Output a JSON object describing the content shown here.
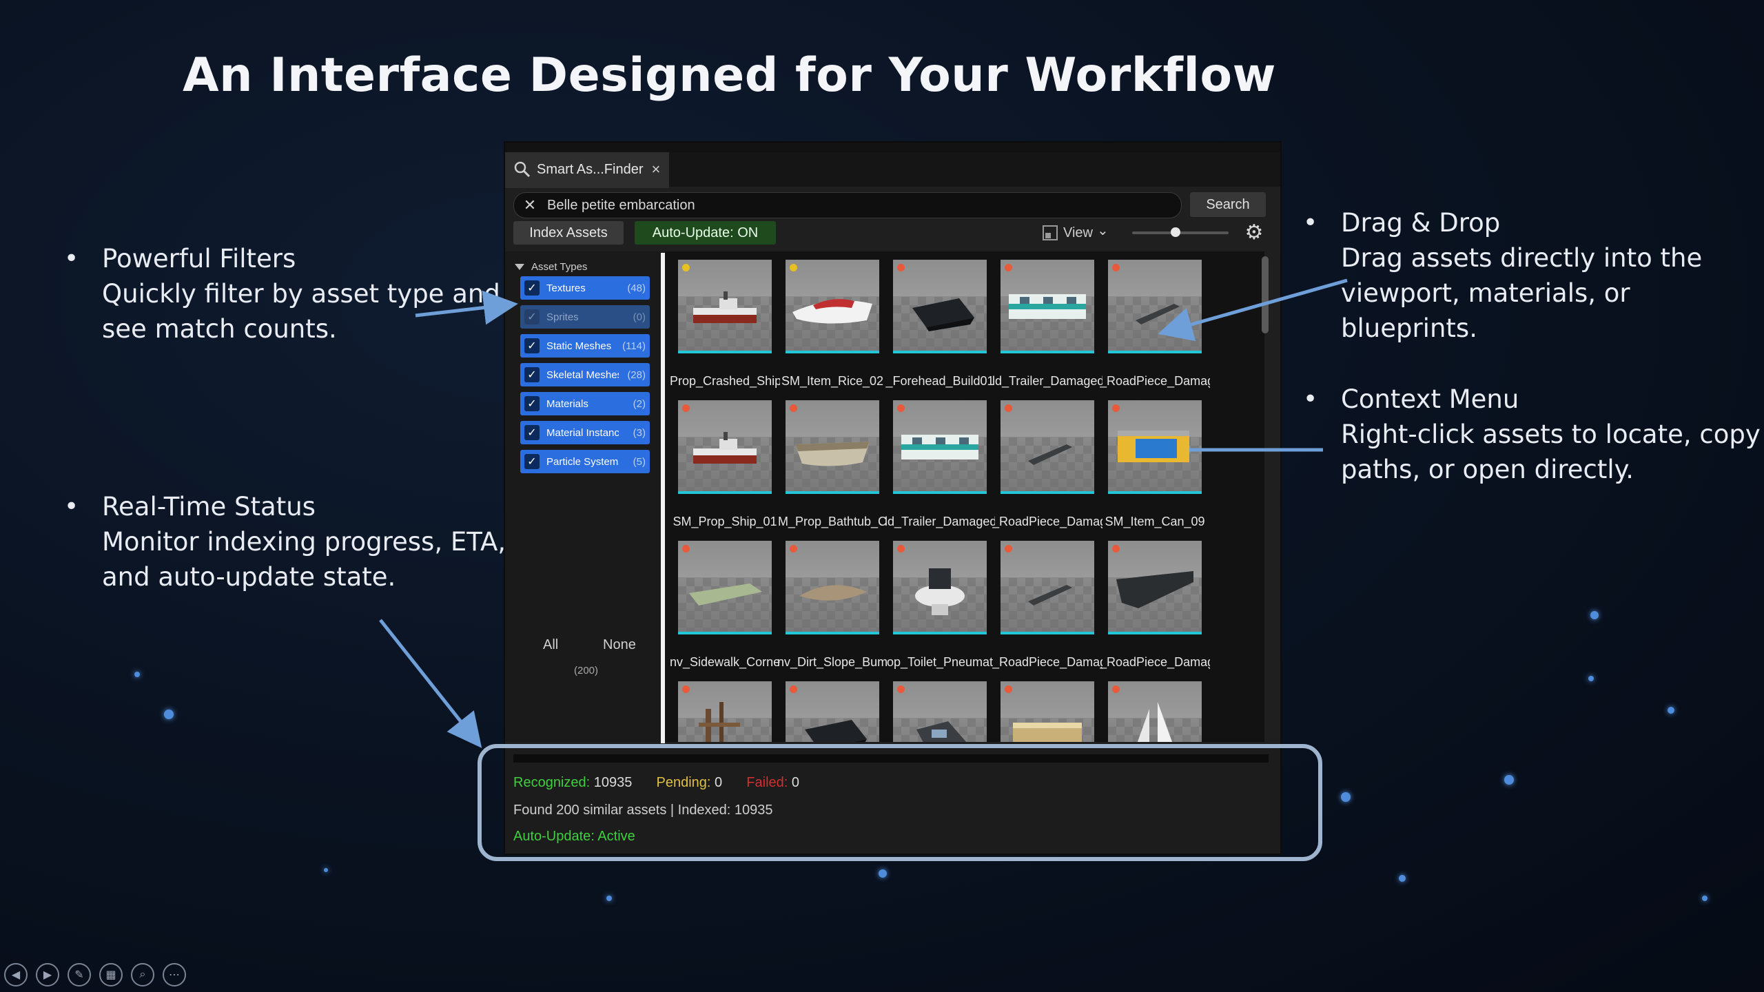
{
  "slide": {
    "title": "An Interface Designed for Your Workflow",
    "bullets_left": [
      {
        "title": "Powerful Filters",
        "lines": [
          "Quickly filter by asset type and",
          "see match counts."
        ]
      },
      {
        "title": "Real-Time Status",
        "lines": [
          "Monitor indexing progress, ETA,",
          "and auto-update state."
        ]
      }
    ],
    "bullets_right": [
      {
        "title": "Drag & Drop",
        "lines": [
          "Drag assets directly into the",
          "viewport, materials, or blueprints."
        ]
      },
      {
        "title": "Context Menu",
        "lines": [
          "Right-click assets to locate, copy",
          "paths, or open directly."
        ]
      }
    ],
    "bullet_glyph": "•"
  },
  "editor": {
    "tab": {
      "label": "Smart As...Finder",
      "close": "×",
      "icon": "search-icon"
    },
    "search": {
      "value": "Belle petite embarcation",
      "clear": "✕",
      "button": "Search"
    },
    "toolbar": {
      "index_label": "Index Assets",
      "auto_update_label": "Auto-Update: ON",
      "view_label": "View",
      "view_chevron": "⌄",
      "settings_icon": "gear-icon",
      "thumb_size_fraction": 0.45
    },
    "filters": {
      "header": "Asset Types",
      "items": [
        {
          "label": "Textures",
          "count": "(48)",
          "checked": true
        },
        {
          "label": "Sprites",
          "count": "(0)",
          "checked": true
        },
        {
          "label": "Static Meshes",
          "count": "(114)",
          "checked": true
        },
        {
          "label": "Skeletal Meshes",
          "count": "(28)",
          "checked": true
        },
        {
          "label": "Materials",
          "count": "(2)",
          "checked": true
        },
        {
          "label": "Material Instances",
          "count": "(3)",
          "checked": true
        },
        {
          "label": "Particle Systems",
          "count": "(5)",
          "checked": true
        }
      ],
      "all_label": "All",
      "none_label": "None",
      "total": "(200)"
    },
    "assets": [
      {
        "name": "Prop_Crashed_Ship",
        "badge": "#e8c020",
        "shape": "ship"
      },
      {
        "name": "SM_Item_Rice_02",
        "badge": "#e8c020",
        "shape": "hull-white"
      },
      {
        "name": "_Forehead_Build01",
        "badge": "#e85a3a",
        "shape": "hull-dark"
      },
      {
        "name": "ld_Trailer_Damaged",
        "badge": "#e85a3a",
        "shape": "trailer"
      },
      {
        "name": "_RoadPiece_Damaged",
        "badge": "#e85a3a",
        "shape": "plank"
      },
      {
        "name": "SM_Prop_Ship_01",
        "badge": "#e85a3a",
        "shape": "ship"
      },
      {
        "name": "M_Prop_Bathtub_C",
        "badge": "#e85a3a",
        "shape": "tub"
      },
      {
        "name": "ld_Trailer_Damaged",
        "badge": "#e85a3a",
        "shape": "trailer"
      },
      {
        "name": "_RoadPiece_Damaged",
        "badge": "#e85a3a",
        "shape": "plank"
      },
      {
        "name": "SM_Item_Can_09",
        "badge": "#e85a3a",
        "shape": "box"
      },
      {
        "name": "nv_Sidewalk_Corner",
        "badge": "#e85a3a",
        "shape": "green"
      },
      {
        "name": "nv_Dirt_Slope_Bum",
        "badge": "#e85a3a",
        "shape": "dirt"
      },
      {
        "name": "op_Toilet_Pneumat",
        "badge": "#e85a3a",
        "shape": "toilet"
      },
      {
        "name": "_RoadPiece_Damaged",
        "badge": "#e85a3a",
        "shape": "plank"
      },
      {
        "name": "_RoadPiece_Damaged",
        "badge": "#e85a3a",
        "shape": "wedge"
      },
      {
        "name": "",
        "badge": "#e85a3a",
        "shape": "wreck"
      },
      {
        "name": "",
        "badge": "#e85a3a",
        "shape": "hull-dark"
      },
      {
        "name": "",
        "badge": "#e85a3a",
        "shape": "debris"
      },
      {
        "name": "",
        "badge": "#e85a3a",
        "shape": "crate"
      },
      {
        "name": "",
        "badge": "#e85a3a",
        "shape": "sail"
      }
    ],
    "status": {
      "recognized_label": "Recognized:",
      "recognized_value": "10935",
      "pending_label": "Pending:",
      "pending_value": "0",
      "failed_label": "Failed:",
      "failed_value": "0",
      "found_text": "Found 200 similar assets | Indexed: 10935",
      "auto_update_status": "Auto-Update: Active"
    }
  },
  "colors": {
    "accent_blue": "#2a6ee0",
    "status_green": "#3fcf3f",
    "pending_yellow": "#e0c040",
    "failed_red": "#d03030",
    "thumb_underline": "#22c6d6",
    "callout": "#9fb5cf"
  }
}
